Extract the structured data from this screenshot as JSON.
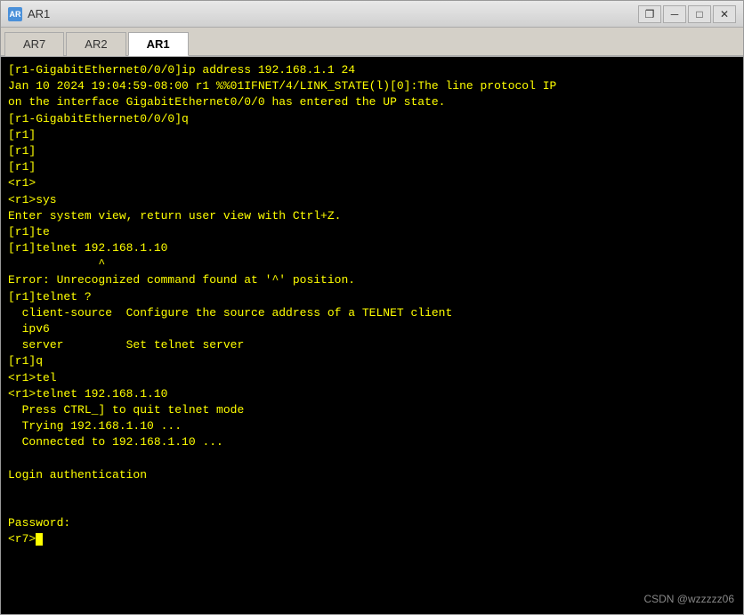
{
  "window": {
    "title": "AR1",
    "icon_label": "AR"
  },
  "tabs": [
    {
      "id": "ar7",
      "label": "AR7",
      "active": false
    },
    {
      "id": "ar2",
      "label": "AR2",
      "active": false
    },
    {
      "id": "ar1",
      "label": "AR1",
      "active": true
    }
  ],
  "terminal": {
    "lines": [
      "[r1-GigabitEthernet0/0/0]ip address 192.168.1.1 24",
      "Jan 10 2024 19:04:59-08:00 r1 %%01IFNET/4/LINK_STATE(l)[0]:The line protocol IP",
      "on the interface GigabitEthernet0/0/0 has entered the UP state.",
      "[r1-GigabitEthernet0/0/0]q",
      "[r1]",
      "[r1]",
      "[r1]",
      "<r1>",
      "<r1>sys",
      "Enter system view, return user view with Ctrl+Z.",
      "[r1]te",
      "[r1]telnet 192.168.1.10",
      "             ^",
      "Error: Unrecognized command found at '^' position.",
      "[r1]telnet ?",
      "  client-source  Configure the source address of a TELNET client",
      "  ipv6",
      "  server         Set telnet server",
      "[r1]q",
      "<r1>tel",
      "<r1>telnet 192.168.1.10",
      "  Press CTRL_] to quit telnet mode",
      "  Trying 192.168.1.10 ...",
      "  Connected to 192.168.1.10 ...",
      "",
      "Login authentication",
      "",
      "",
      "Password:",
      "<r7>"
    ],
    "cursor_visible": true
  },
  "watermark": {
    "text": "CSDN @wzzzzz06"
  },
  "title_buttons": {
    "restore": "❐",
    "minimize": "─",
    "maximize": "□",
    "close": "✕"
  }
}
